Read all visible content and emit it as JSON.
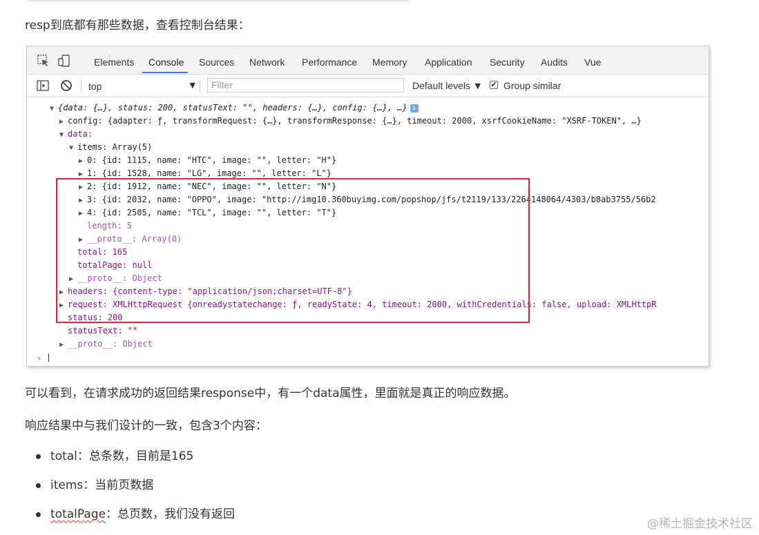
{
  "article": {
    "intro": "resp到底都有那些数据，查看控制台结果：",
    "after_shot": "可以看到，在请求成功的返回结果response中，有一个data属性，里面就是真正的响应数据。",
    "consistent": "响应结果中与我们设计的一致，包含3个内容：",
    "bullets": [
      {
        "key": "total",
        "desc": "：总条数，目前是165"
      },
      {
        "key": "items",
        "desc": "：当前页数据"
      },
      {
        "key": "totalPage",
        "desc": "：总页数，我们没有返回"
      }
    ],
    "watermark": "@稀土掘金技术社区"
  },
  "devtools": {
    "tabs": [
      "Elements",
      "Console",
      "Sources",
      "Network",
      "Performance",
      "Memory",
      "Application",
      "Security",
      "Audits",
      "Vue"
    ],
    "active_tab": "Console",
    "context": "top",
    "filter_placeholder": "Filter",
    "levels": "Default levels ▼",
    "group_similar": "Group similar",
    "icons": [
      "inspect-icon",
      "device-icon",
      "sidebar-icon",
      "clear-icon"
    ]
  },
  "console_lines": {
    "root": "{data: {…}, status: 200, statusText: \"\", headers: {…}, config: {…}, …}",
    "config": "config: {adapter: ƒ, transformRequest: {…}, transformResponse: {…}, timeout: 2000, xsrfCookieName: \"XSRF-TOKEN\", …}",
    "data": "data:",
    "items": "items: Array(5)",
    "item0": "0: {id: 1115, name: \"HTC\", image: \"\", letter: \"H\"}",
    "item1": "1: {id: 1528, name: \"LG\", image: \"\", letter: \"L\"}",
    "item2": "2: {id: 1912, name: \"NEC\", image: \"\", letter: \"N\"}",
    "item3": "3: {id: 2032, name: \"OPPO\", image: \"http://img10.360buyimg.com/popshop/jfs/t2119/133/2264148064/4303/b8ab3755/56b2",
    "item4": "4: {id: 2505, name: \"TCL\", image: \"\", letter: \"T\"}",
    "length": "length: 5",
    "items_proto": "__proto__: Array(0)",
    "total": "total: 165",
    "totalPage": "totalPage: null",
    "data_proto": "__proto__: Object",
    "headers": "headers: {content-type: \"application/json;charset=UTF-8\"}",
    "request": "request: XMLHttpRequest {onreadystatechange: ƒ, readyState: 4, timeout: 2000, withCredentials: false, upload: XMLHttpR",
    "status": "status: 200",
    "statusText": "statusText: \"\"",
    "root_proto": "__proto__: Object"
  },
  "colors": {
    "highlight_box": "#e0282e",
    "active_tab_underline": "#3b7ce9"
  }
}
